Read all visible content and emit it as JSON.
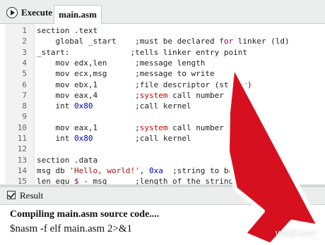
{
  "toolbar": {
    "execute_label": "Execute",
    "tab_label": "main.asm"
  },
  "editor": {
    "lines": [
      {
        "n": "1",
        "segs": [
          {
            "t": "section .text",
            "c": "code-text"
          }
        ]
      },
      {
        "n": "2",
        "segs": [
          {
            "t": "    global _start    ;must be declared ",
            "c": ""
          },
          {
            "t": "for",
            "c": "kw"
          },
          {
            "t": " linker (ld)",
            "c": ""
          }
        ]
      },
      {
        "n": "3",
        "segs": [
          {
            "t": "_start:             ;tells linker entry point",
            "c": ""
          }
        ]
      },
      {
        "n": "4",
        "segs": [
          {
            "t": "    mov edx,len      ;message length",
            "c": ""
          }
        ]
      },
      {
        "n": "5",
        "segs": [
          {
            "t": "    mov ecx,msg      ;message to write",
            "c": ""
          }
        ]
      },
      {
        "n": "6",
        "segs": [
          {
            "t": "    mov ebx,1        ;file descriptor (stdout)",
            "c": ""
          }
        ]
      },
      {
        "n": "7",
        "segs": [
          {
            "t": "    mov eax,4        ;",
            "c": ""
          },
          {
            "t": "system",
            "c": "sys"
          },
          {
            "t": " call number (sys_",
            "c": ""
          }
        ]
      },
      {
        "n": "8",
        "segs": [
          {
            "t": "    int ",
            "c": ""
          },
          {
            "t": "0x80",
            "c": "num"
          },
          {
            "t": "         ;call kernel",
            "c": ""
          }
        ]
      },
      {
        "n": "9",
        "segs": [
          {
            "t": "",
            "c": ""
          }
        ]
      },
      {
        "n": "10",
        "segs": [
          {
            "t": "    mov eax,1        ;",
            "c": ""
          },
          {
            "t": "system",
            "c": "sys"
          },
          {
            "t": " call number (sys_",
            "c": ""
          }
        ]
      },
      {
        "n": "11",
        "segs": [
          {
            "t": "    int ",
            "c": ""
          },
          {
            "t": "0x80",
            "c": "num"
          },
          {
            "t": "         ;call kernel",
            "c": ""
          }
        ]
      },
      {
        "n": "12",
        "segs": [
          {
            "t": "",
            "c": ""
          }
        ]
      },
      {
        "n": "13",
        "segs": [
          {
            "t": "section .data",
            "c": ""
          }
        ]
      },
      {
        "n": "14",
        "segs": [
          {
            "t": "msg db ",
            "c": ""
          },
          {
            "t": "'Hello, world!'",
            "c": "str"
          },
          {
            "t": ", ",
            "c": ""
          },
          {
            "t": "0xa",
            "c": "num"
          },
          {
            "t": "  ;string to be pr",
            "c": ""
          }
        ]
      },
      {
        "n": "15",
        "segs": [
          {
            "t": "len equ ",
            "c": ""
          },
          {
            "t": "$",
            "c": "kw"
          },
          {
            "t": " - msg      ;length of the string",
            "c": ""
          }
        ]
      }
    ]
  },
  "result": {
    "label": "Result",
    "line1": "Compiling main.asm source code....",
    "line2": "$nasm -f elf main.asm 2>&1"
  },
  "watermark": {
    "wiki": "wiki",
    "how": "How"
  },
  "colors": {
    "arrow_fill": "#d7101f",
    "arrow_outline": "#ffffff"
  },
  "icons": {
    "execute": "play-circle-icon",
    "result": "checkbox-icon",
    "pointer": "cursor-arrow-icon"
  }
}
